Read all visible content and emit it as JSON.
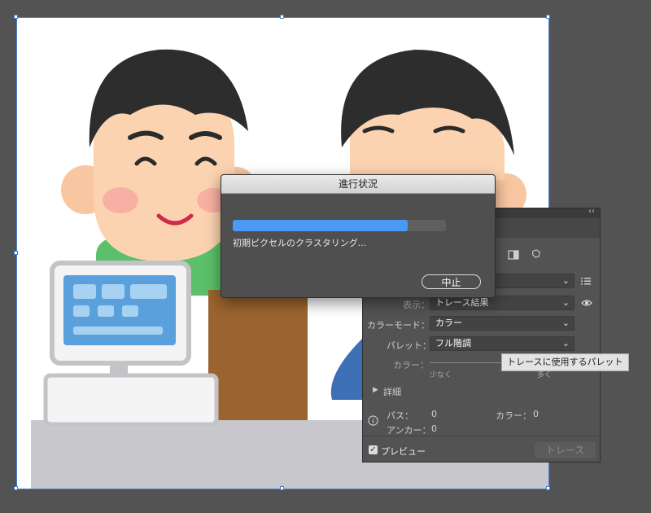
{
  "progress_dialog": {
    "title": "進行状況",
    "status": "初期ピクセルのクラスタリング...",
    "progress": 0.82,
    "stop_label": "中止",
    "fill_color": "#4a9af5"
  },
  "trace_panel": {
    "collapse_glyph": "‹‹",
    "view_label": "表示：",
    "view_value": "トレース結果",
    "color_mode_label": "カラーモード：",
    "color_mode_value": "カラー",
    "palette_label": "パレット：",
    "palette_value": "フル階調",
    "colors_label": "カラー：",
    "slider_min_label": "少なく",
    "slider_max_label": "多く",
    "advanced_label": "詳細",
    "paths_label": "パス：",
    "paths_value": "0",
    "anchors_label": "アンカー：",
    "anchors_value": "0",
    "colors_count_label": "カラー：",
    "colors_count_value": "0",
    "preview_label": "プレビュー",
    "preview_checked": true,
    "trace_label": "トレース",
    "tooltip": "トレースに使用するパレット",
    "icons": [
      "auto-color-icon",
      "high-color-icon",
      "low-color-icon",
      "grayscale-icon",
      "black-white-icon",
      "outline-icon",
      "list-icon",
      "eye-icon",
      "info-icon"
    ]
  },
  "artboard": {
    "selection_color": "#4a7fd4"
  }
}
